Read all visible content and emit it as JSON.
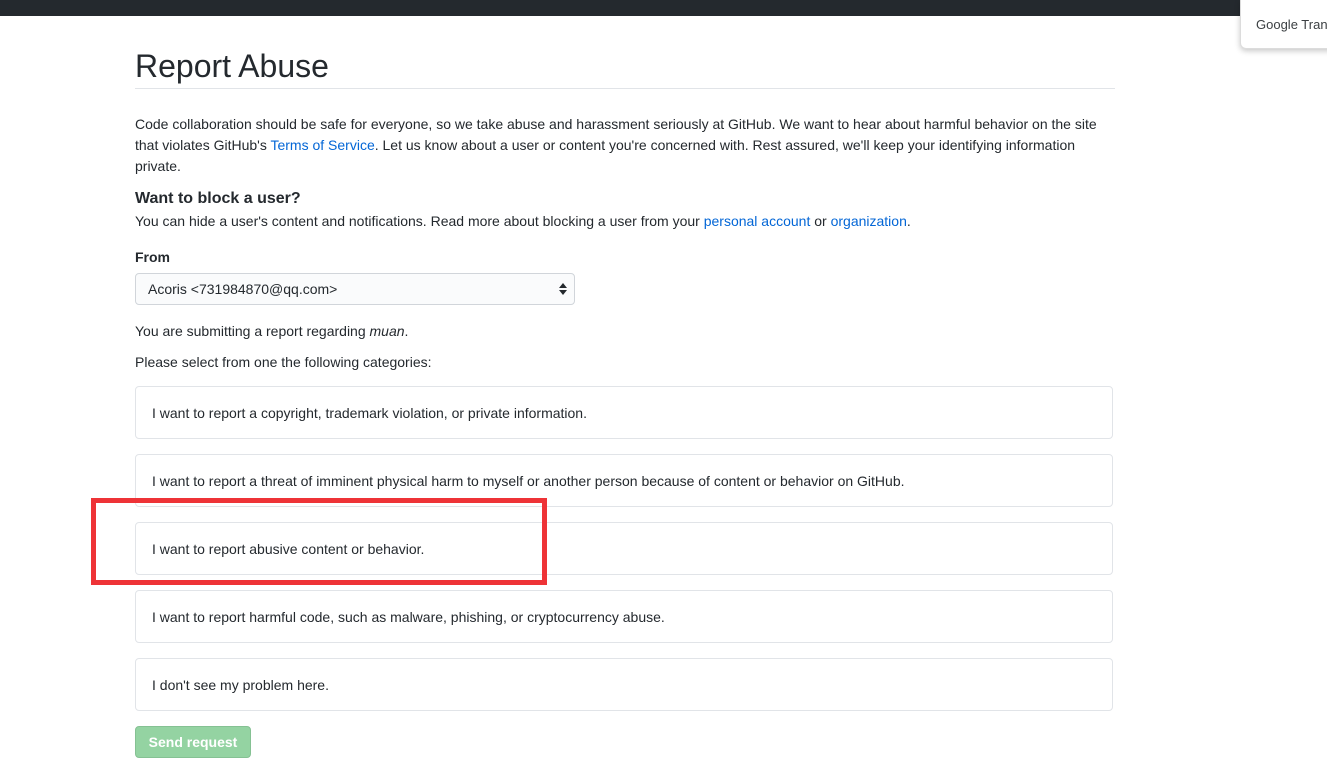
{
  "google_translate": {
    "label": "Google Trans"
  },
  "page": {
    "title": "Report Abuse",
    "intro": {
      "text_before": "Code collaboration should be safe for everyone, so we take abuse and harassment seriously at GitHub. We want to hear about harmful behavior on the site that violates GitHub's ",
      "tos_link": "Terms of Service",
      "text_after": ". Let us know about a user or content you're concerned with. Rest assured, we'll keep your identifying information private."
    },
    "block": {
      "heading": "Want to block a user?",
      "text_before": "You can hide a user's content and notifications. Read more about blocking a user from your ",
      "personal_link": "personal account",
      "or_text": " or ",
      "org_link": "organization",
      "period": "."
    },
    "from": {
      "label": "From",
      "selected": "Acoris <731984870@qq.com>"
    },
    "report_info": {
      "prefix": "You are submitting a report regarding ",
      "username": "muan",
      "suffix": "."
    },
    "select_prompt": "Please select from one the following categories:",
    "categories": [
      "I want to report a copyright, trademark violation, or private information.",
      "I want to report a threat of imminent physical harm to myself or another person because of content or behavior on GitHub.",
      "I want to report abusive content or behavior.",
      "I want to report harmful code, such as malware, phishing, or cryptocurrency abuse.",
      "I don't see my problem here."
    ],
    "send_button": "Send request"
  },
  "colors": {
    "link": "#0366d6",
    "highlight": "#ee3337",
    "send_button_disabled": "#94d3a2"
  }
}
